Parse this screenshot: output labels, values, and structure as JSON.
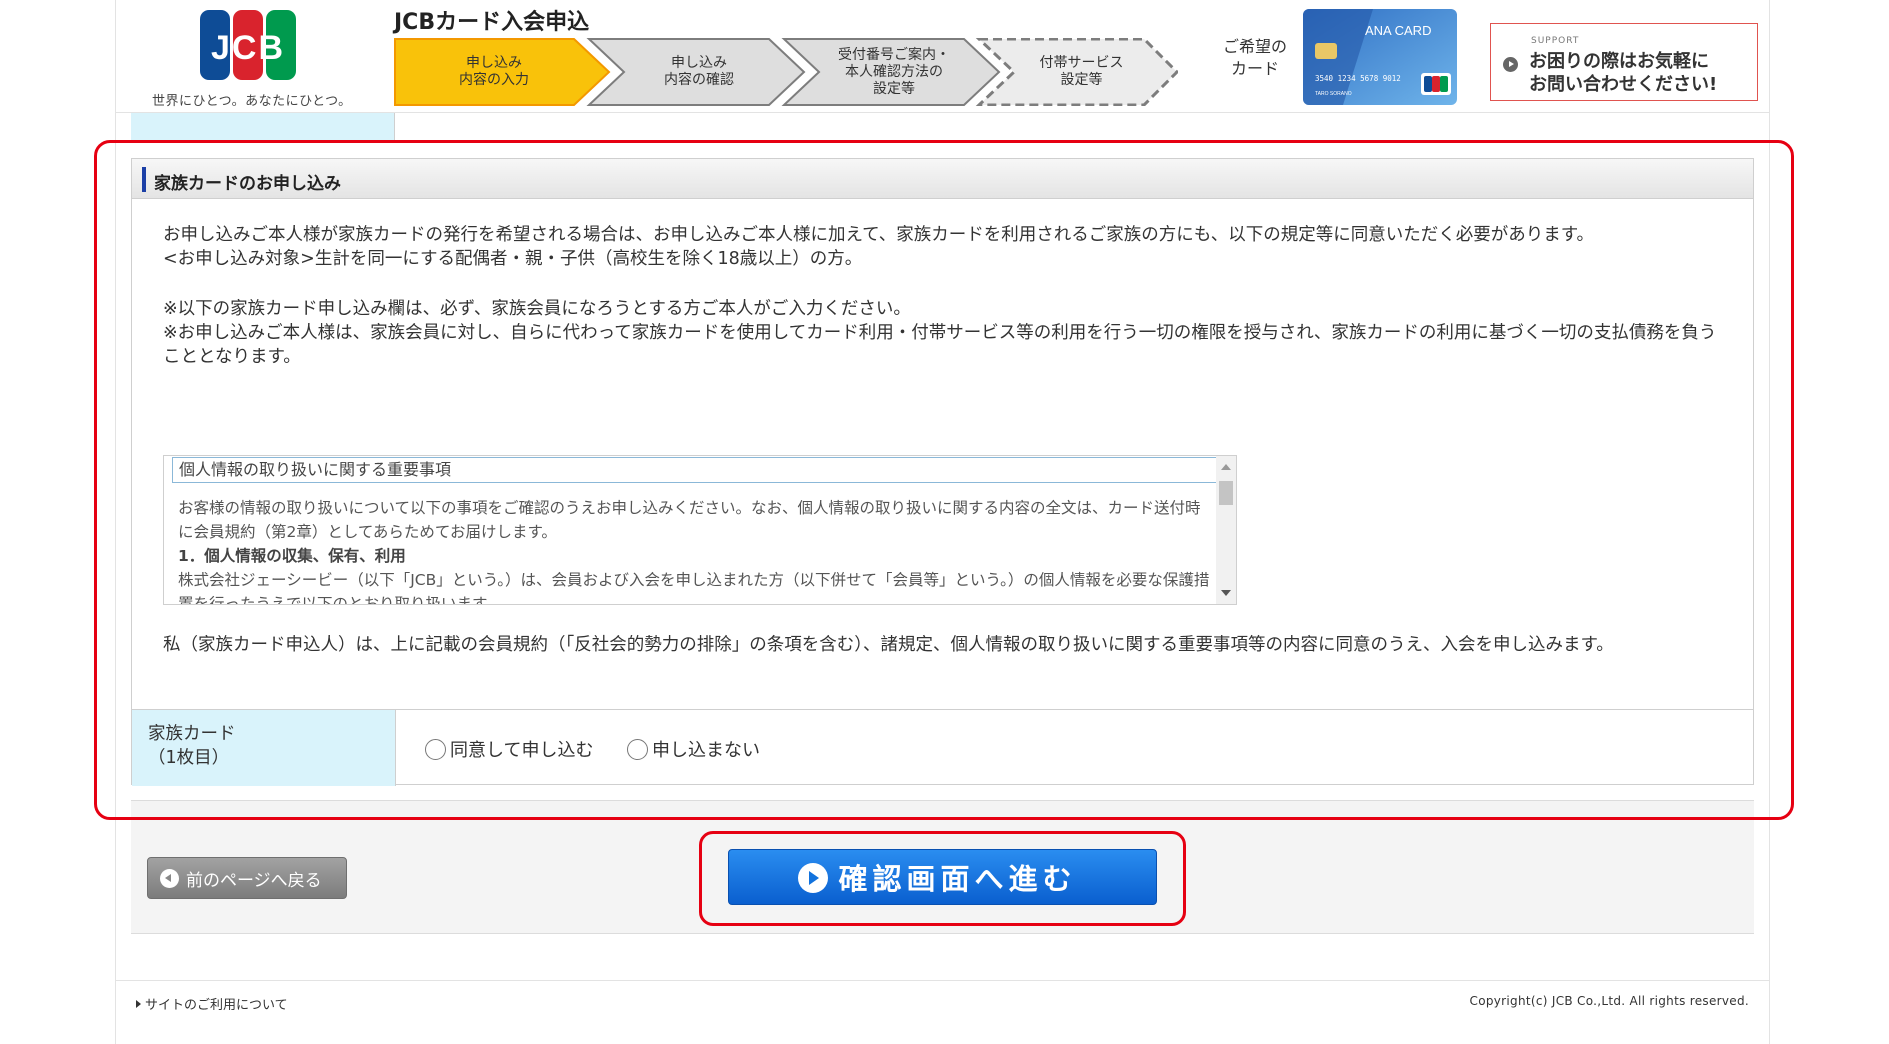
{
  "header": {
    "logo_text": "JCB",
    "logo_tagline": "世界にひとつ。あなたにひとつ。",
    "title": "JCBカード入会申込",
    "steps": [
      {
        "label": "申し込み\n内容の入力",
        "state": "current"
      },
      {
        "label": "申し込み\n内容の確認",
        "state": "upcoming"
      },
      {
        "label": "受付番号ご案内・\n本人確認方法の\n設定等",
        "state": "upcoming"
      },
      {
        "label": "付帯サービス\n設定等",
        "state": "upcoming"
      }
    ],
    "wish_card_label": "ご希望の\nカード",
    "card": {
      "brand": "ANA CARD",
      "number": "3540 1234 5678 9012",
      "name": "TARO SORANO"
    },
    "support": {
      "small_label": "SUPPORT",
      "text": "お困りの際はお気軽に\nお問い合わせください!"
    }
  },
  "family_section": {
    "title": "家族カードのお申し込み",
    "intro": [
      "お申し込みご本人様が家族カードの発行を希望される場合は、お申し込みご本人様に加えて、家族カードを利用されるご家族の方にも、以下の規定等に同意いただく必要があります。",
      "<お申し込み対象>生計を同一にする配偶者・親・子供（高校生を除く18歳以上）の方。"
    ],
    "notes": [
      "※以下の家族カード申し込み欄は、必ず、家族会員になろうとする方ご本人がご入力ください。",
      "※お申し込みご本人様は、家族会員に対し、自らに代わって家族カードを使用してカード利用・付帯サービス等の利用を行う一切の権限を授与され、家族カードの利用に基づく一切の支払債務を負うこととなります。"
    ],
    "privacy_box": {
      "title": "個人情報の取り扱いに関する重要事項",
      "lines": [
        "お客様の情報の取り扱いについて以下の事項をご確認のうえお申し込みください。なお、個人情報の取り扱いに関する内容の全文は、カード送付時に会員規約（第2章）としてあらためてお届けします。",
        "1．個人情報の収集、保有、利用",
        "株式会社ジェーシービー（以下「JCB」という。）は、会員および入会を申し込まれた方（以下併せて「会員等」という。）の個人情報を必要な保護措置を行ったうえで以下のとおり取り扱います。"
      ]
    },
    "agreement": "私（家族カード申込人）は、上に記載の会員規約（「反社会的勢力の排除」の条項を含む）、諸規定、個人情報の取り扱いに関する重要事項等の内容に同意のうえ、入会を申し込みます。",
    "row": {
      "label_line1": "家族カード",
      "label_line2": "（1枚目）",
      "options": [
        "同意して申し込む",
        "申し込まない"
      ],
      "selected": null
    }
  },
  "nav": {
    "back_label": "前のページへ戻る",
    "next_label": "確認画面へ進む"
  },
  "footer": {
    "link": "サイトのご利用について",
    "copyright": "Copyright(c) JCB Co.,Ltd. All rights reserved."
  },
  "colors": {
    "accent_blue": "#0a66d6",
    "current_step": "#f9c20a",
    "highlight_red": "#e60012",
    "label_cell": "#d9f3fb"
  }
}
